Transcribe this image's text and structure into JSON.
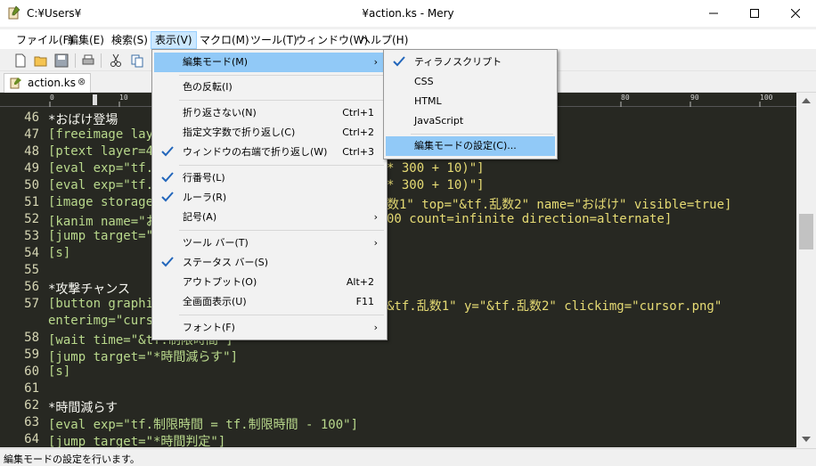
{
  "window": {
    "path": "C:¥Users¥",
    "title": "¥action.ks - Mery"
  },
  "menubar": [
    {
      "label": "ファイル(F)"
    },
    {
      "label": "編集(E)"
    },
    {
      "label": "検索(S)"
    },
    {
      "label": "表示(V)"
    },
    {
      "label": "マクロ(M)"
    },
    {
      "label": "ツール(T)"
    },
    {
      "label": "ウィンドウ(W)"
    },
    {
      "label": "ヘルプ(H)"
    }
  ],
  "tab": {
    "label": "action.ks",
    "close": "⊗"
  },
  "ruler": [
    "0",
    "10",
    "80",
    "90",
    "100"
  ],
  "editor": {
    "lines": [
      {
        "n": "46",
        "text": "*おばけ登場"
      },
      {
        "n": "47",
        "text": "[freeimage laye"
      },
      {
        "n": "48",
        "text": "[ptext layer=4"
      },
      {
        "n": "49",
        "text": "[eval exp=\"tf.",
        "tail": "* 300 + 10)\"]"
      },
      {
        "n": "50",
        "text": "[eval exp=\"tf.",
        "tail": "* 300 + 10)\"]"
      },
      {
        "n": "51",
        "text": "[image storage",
        "tail": "数1\" top=\"&tf.乱数2\" name=\"おばけ\" visible=true]"
      },
      {
        "n": "52",
        "text": "[kanim name=\"お",
        "tail": "00 count=infinite direction=alternate]"
      },
      {
        "n": "53",
        "text": "[jump target=\"*"
      },
      {
        "n": "54",
        "text": "[s]"
      },
      {
        "n": "55",
        "text": ""
      },
      {
        "n": "56",
        "text": "*攻撃チャンス"
      },
      {
        "n": "57",
        "text": "[button graphic",
        "tail": "&tf.乱数1\" y=\"&tf.乱数2\" clickimg=\"cursor.png\""
      },
      {
        "n": "",
        "text": "enterimg=\"curso"
      },
      {
        "n": "58",
        "text": "[wait time=\"&tf.制限時間\"]"
      },
      {
        "n": "59",
        "text": "[jump target=\"*時間減らす\"]"
      },
      {
        "n": "60",
        "text": "[s]"
      },
      {
        "n": "61",
        "text": ""
      },
      {
        "n": "62",
        "text": "*時間減らす"
      },
      {
        "n": "63",
        "text": "[eval exp=\"tf.制限時間 = tf.制限時間 - 100\"]"
      },
      {
        "n": "64",
        "text": "[jump target=\"*時間判定\"]"
      }
    ]
  },
  "view_menu": {
    "items": [
      {
        "label": "編集モード(M)",
        "submenu": true
      },
      {
        "label": "色の反転(I)"
      },
      {
        "label": "折り返さない(N)",
        "shortcut": "Ctrl+1"
      },
      {
        "label": "指定文字数で折り返し(C)",
        "shortcut": "Ctrl+2"
      },
      {
        "label": "ウィンドウの右端で折り返し(W)",
        "shortcut": "Ctrl+3",
        "checked": true
      },
      {
        "label": "行番号(L)",
        "checked": true
      },
      {
        "label": "ルーラ(R)",
        "checked": true
      },
      {
        "label": "記号(A)",
        "submenu": true
      },
      {
        "label": "ツール バー(T)",
        "submenu": true
      },
      {
        "label": "ステータス バー(S)",
        "checked": true
      },
      {
        "label": "アウトプット(O)",
        "shortcut": "Alt+2"
      },
      {
        "label": "全画面表示(U)",
        "shortcut": "F11"
      },
      {
        "label": "フォント(F)",
        "submenu": true
      }
    ]
  },
  "mode_menu": {
    "items": [
      {
        "label": "ティラノスクリプト",
        "checked": true
      },
      {
        "label": "CSS"
      },
      {
        "label": "HTML"
      },
      {
        "label": "JavaScript"
      },
      {
        "label": "編集モードの設定(C)..."
      }
    ]
  },
  "status": {
    "text": "編集モードの設定を行います。"
  },
  "colors": {
    "editor_bg": "#272822",
    "menu_highlight": "#91c9f7",
    "active_menu": "#cce8ff"
  }
}
